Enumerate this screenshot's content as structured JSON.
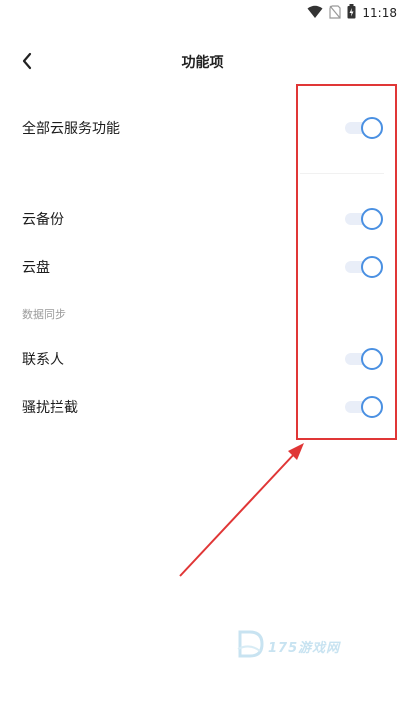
{
  "status_bar": {
    "time": "11:18"
  },
  "header": {
    "title": "功能项"
  },
  "rows": {
    "all_cloud": {
      "label": "全部云服务功能",
      "enabled": true
    },
    "cloud_backup": {
      "label": "云备份",
      "enabled": true
    },
    "cloud_disk": {
      "label": "云盘",
      "enabled": true
    },
    "contacts": {
      "label": "联系人",
      "enabled": true
    },
    "harassment_block": {
      "label": "骚扰拦截",
      "enabled": true
    }
  },
  "sections": {
    "data_sync": "数据同步"
  },
  "watermark": {
    "text": "175游戏网",
    "logo": "D"
  },
  "colors": {
    "toggle_accent": "#4a90e2",
    "annotation": "#e03636"
  }
}
